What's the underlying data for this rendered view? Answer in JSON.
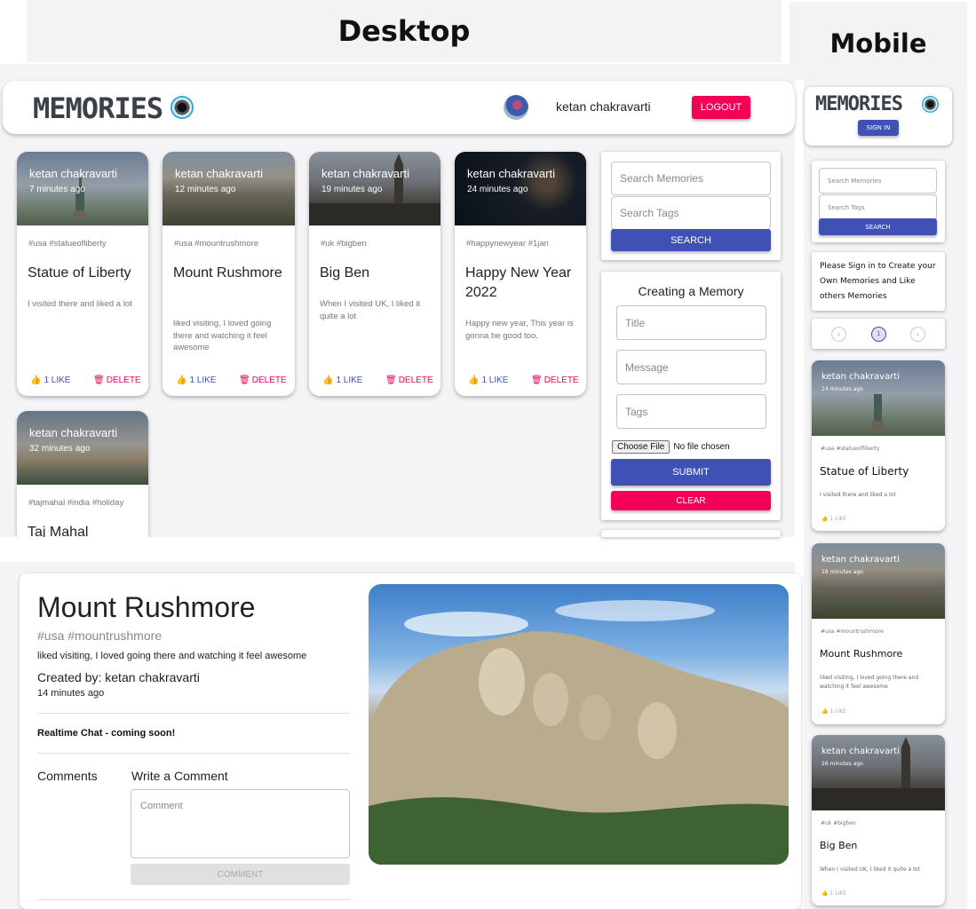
{
  "headers": {
    "desktop": "Desktop",
    "mobile": "Mobile"
  },
  "app": {
    "logo": "MEMORIES"
  },
  "appbar": {
    "user_name": "ketan chakravarti",
    "logout_label": "LOGOUT"
  },
  "posts": [
    {
      "creator": "ketan chakravarti",
      "time": "7 minutes ago",
      "tags": "#usa #statueofliberty",
      "title": "Statue of Liberty",
      "message": "I visited there and liked a lot",
      "like": "1 LIKE",
      "delete": "DELETE"
    },
    {
      "creator": "ketan chakravarti",
      "time": "12 minutes ago",
      "tags": "#usa #mountrushmore",
      "title": "Mount Rushmore",
      "message": "liked visiting, I loved going there and watching it feel awesome",
      "like": "1 LIKE",
      "delete": "DELETE"
    },
    {
      "creator": "ketan chakravarti",
      "time": "19 minutes ago",
      "tags": "#uk #bigben",
      "title": "Big Ben",
      "message": "When I visited UK, I liked it quite a lot",
      "like": "1 LIKE",
      "delete": "DELETE"
    },
    {
      "creator": "ketan chakravarti",
      "time": "24 minutes ago",
      "tags": "#happynewyear #1jan",
      "title": "Happy New Year 2022",
      "message": "Happy new year, This year is gonna be good too.",
      "like": "1 LIKE",
      "delete": "DELETE"
    },
    {
      "creator": "ketan chakravarti",
      "time": "32 minutes ago",
      "tags": "#tajmahal #india #holiday",
      "title": "Taj Mahal"
    }
  ],
  "search": {
    "memories_placeholder": "Search Memories",
    "tags_placeholder": "Search Tags",
    "button": "SEARCH"
  },
  "form": {
    "heading": "Creating a Memory",
    "title_placeholder": "Title",
    "message_placeholder": "Message",
    "tags_placeholder": "Tags",
    "choose_file": "Choose File",
    "no_file": "No file chosen",
    "submit": "SUBMIT",
    "clear": "CLEAR"
  },
  "detail": {
    "title": "Mount Rushmore",
    "tags": "#usa #mountrushmore",
    "message": "liked visiting, I loved going there and watching it feel awesome",
    "created_by": "Created by: ketan chakravarti",
    "time": "14 minutes ago",
    "chat_note": "Realtime Chat - coming soon!",
    "comments_label": "Comments",
    "write_comment": "Write a Comment",
    "comment_placeholder": "Comment",
    "comment_button": "COMMENT"
  },
  "mobile": {
    "logo": "MEMORIES",
    "sign_in": "SIGN IN",
    "search_placeholder": "Search Memories",
    "tags_placeholder": "Search Tags",
    "search_button": "SEARCH",
    "sign_in_note": "Please Sign in to Create your Own Memories and Like others Memories",
    "page": "1",
    "posts": [
      {
        "creator": "ketan chakravarti",
        "time": "14 minutes ago",
        "tags": "#usa #statueofliberty",
        "title": "Statue of Liberty",
        "message": "I visited there and liked a lot",
        "like": "1 LIKE"
      },
      {
        "creator": "ketan chakravarti",
        "time": "18 minutes ago",
        "tags": "#usa #mountrushmore",
        "title": "Mount Rushmore",
        "message": "liked visiting, I loved going there and watching it feel awesome",
        "like": "1 LIKE"
      },
      {
        "creator": "ketan chakravarti",
        "time": "26 minutes ago",
        "tags": "#uk #bigben",
        "title": "Big Ben",
        "message": "When I visited UK, I liked it quite a lot",
        "like": "1 LIKE"
      }
    ]
  },
  "colors": {
    "primary": "#3f51b5",
    "secondary": "#f50057"
  }
}
